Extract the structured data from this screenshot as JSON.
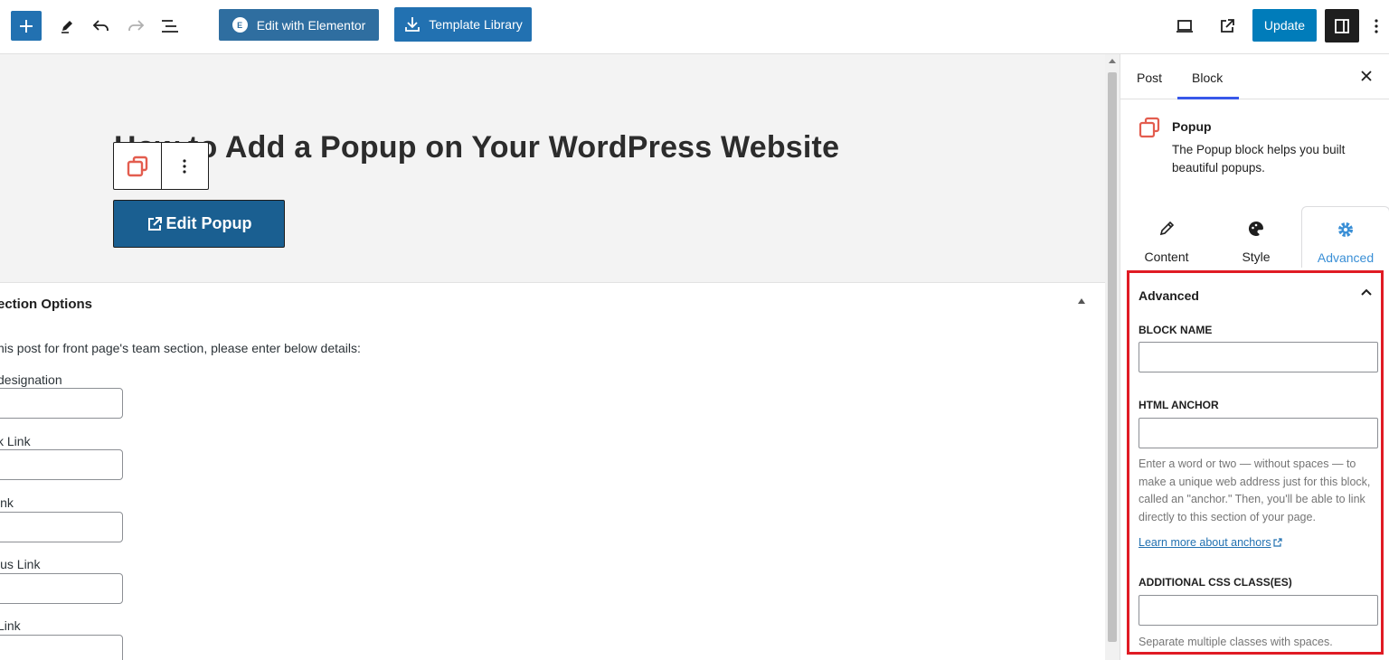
{
  "toolbar": {
    "elementor_label": "Edit with Elementor",
    "elementor_badge": "E",
    "template_label": "Template Library",
    "update_label": "Update"
  },
  "canvas": {
    "post_title": "How to Add a Popup on Your WordPress Website",
    "edit_popup_label": "Edit Popup",
    "meta": {
      "title": "ection Options",
      "description": "his post for front page's team section, please enter below details:",
      "fields": [
        {
          "label": " designation"
        },
        {
          "label": "k Link"
        },
        {
          "label": "ink"
        },
        {
          "label": "lus Link"
        },
        {
          "label": " Link"
        }
      ]
    }
  },
  "sidebar": {
    "tabs": [
      "Post",
      "Block"
    ],
    "block": {
      "name": "Popup",
      "description": "The Popup block helps you built beautiful popups."
    },
    "inspector_tabs": [
      "Content",
      "Style",
      "Advanced"
    ],
    "advanced": {
      "title": "Advanced",
      "block_name_label": "BLOCK NAME",
      "html_anchor_label": "HTML ANCHOR",
      "anchor_help": "Enter a word or two — without spaces — to make a unique web address just for this block, called an \"anchor.\" Then, you'll be able to link directly to this section of your page.",
      "learn_more": "Learn more about anchors",
      "css_class_label": "ADDITIONAL CSS CLASS(ES)",
      "css_help": "Separate multiple classes with spaces."
    }
  },
  "colors": {
    "accent": "#2271b1",
    "highlight_border": "#e01b24",
    "popup_icon": "#e35d4f"
  }
}
